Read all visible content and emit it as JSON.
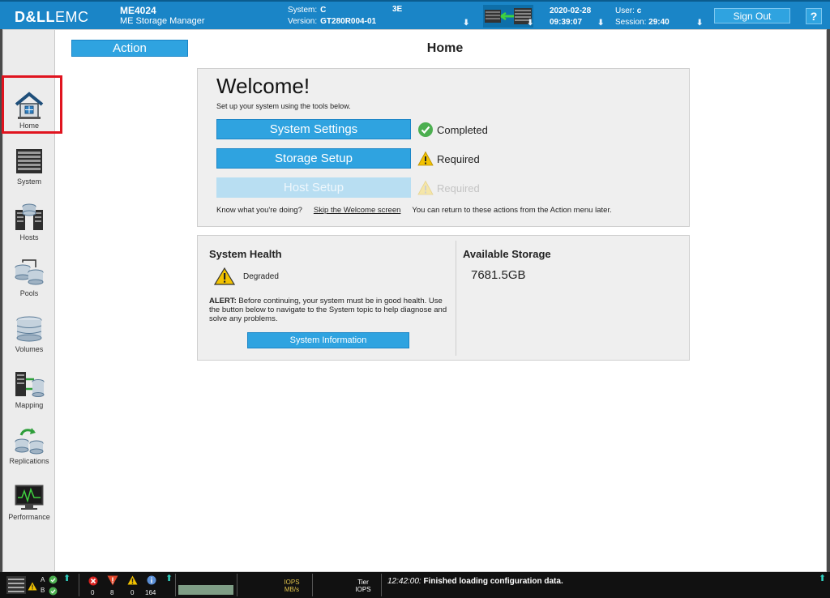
{
  "header": {
    "brand_bold": "D&LL",
    "brand_light": "EMC",
    "model": "ME4024",
    "product": "ME Storage Manager",
    "system_label": "System:",
    "system_value": "C",
    "system_suffix": "3E",
    "version_label": "Version:",
    "version_value": "GT280R004-01",
    "date": "2020-02-28",
    "time": "09:39:07",
    "user_label": "User:",
    "user_value": "c",
    "session_label": "Session:",
    "session_value": "29:40",
    "sign_out": "Sign Out",
    "help": "?"
  },
  "sidebar": {
    "items": [
      {
        "label": "Home",
        "icon": "home-icon"
      },
      {
        "label": "System",
        "icon": "system-icon"
      },
      {
        "label": "Hosts",
        "icon": "hosts-icon"
      },
      {
        "label": "Pools",
        "icon": "pools-icon"
      },
      {
        "label": "Volumes",
        "icon": "volumes-icon"
      },
      {
        "label": "Mapping",
        "icon": "mapping-icon"
      },
      {
        "label": "Replications",
        "icon": "replications-icon"
      },
      {
        "label": "Performance",
        "icon": "performance-icon"
      }
    ]
  },
  "main": {
    "action_label": "Action",
    "title": "Home",
    "welcome": {
      "heading": "Welcome!",
      "intro": "Set up your system using the tools below.",
      "tasks": [
        {
          "label": "System Settings",
          "status": "Completed",
          "status_icon": "check-icon",
          "enabled": true
        },
        {
          "label": "Storage Setup",
          "status": "Required",
          "status_icon": "warning-icon",
          "enabled": true
        },
        {
          "label": "Host Setup",
          "status": "Required",
          "status_icon": "warning-icon",
          "enabled": false
        }
      ],
      "know_text": "Know what you're doing?",
      "skip_link": "Skip the Welcome screen",
      "return_text": "You can return to these actions from the Action menu later."
    },
    "health": {
      "heading": "System Health",
      "state": "Degraded",
      "alert_prefix": "ALERT:",
      "alert_text": "Before continuing, your system must be in good health. Use the button below to navigate to the System topic to help diagnose and solve any problems.",
      "button": "System Information"
    },
    "storage": {
      "heading": "Available Storage",
      "value": "7681.5GB"
    }
  },
  "statusbar": {
    "controller_a": "A",
    "controller_b": "B",
    "error_count": "0",
    "critical_count": "8",
    "warning_count": "0",
    "info_count": "164",
    "iops_label": "IOPS",
    "mbs_label": "MB/s",
    "tier_label": "Tier",
    "tier_iops_label": "IOPS",
    "message_time": "12:42:00:",
    "message": "Finished loading configuration data."
  },
  "colors": {
    "header_blue": "#1a85c7",
    "button_blue": "#2fa3e0",
    "highlight_red": "#e0141f",
    "success_green": "#4caf50",
    "warning_yellow": "#f2c200"
  }
}
